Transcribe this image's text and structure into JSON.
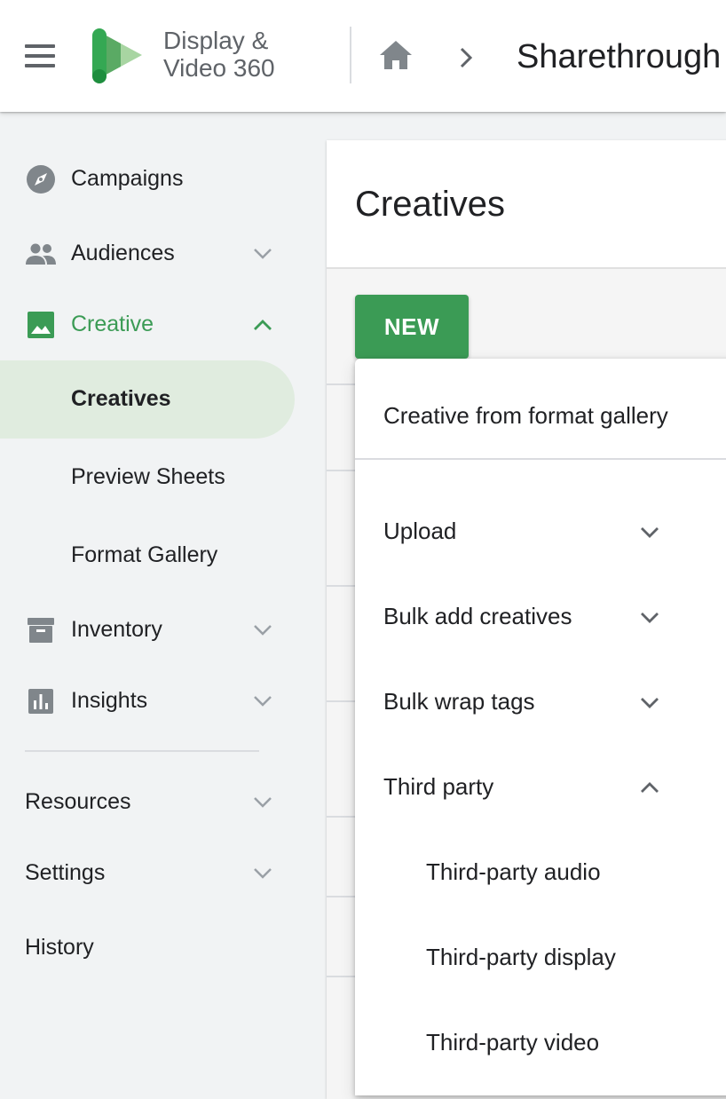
{
  "header": {
    "product_line1": "Display &",
    "product_line2": "Video 360",
    "account": "Sharethrough"
  },
  "sidebar": {
    "items": [
      {
        "label": "Campaigns",
        "icon": "compass-icon"
      },
      {
        "label": "Audiences",
        "icon": "people-icon",
        "chevron": "down"
      },
      {
        "label": "Creative",
        "icon": "image-icon",
        "chevron": "up",
        "expanded": true
      },
      {
        "label": "Inventory",
        "icon": "archive-icon",
        "chevron": "down"
      },
      {
        "label": "Insights",
        "icon": "bar-chart-icon",
        "chevron": "down"
      }
    ],
    "creative_sub": [
      "Creatives",
      "Preview Sheets",
      "Format Gallery"
    ],
    "bottom": [
      {
        "label": "Resources",
        "chevron": "down"
      },
      {
        "label": "Settings",
        "chevron": "down"
      },
      {
        "label": "History"
      }
    ]
  },
  "main": {
    "title": "Creatives",
    "new_button": "NEW"
  },
  "menu": {
    "gallery": "Creative from format gallery",
    "groups": [
      {
        "label": "Upload",
        "chevron": "down"
      },
      {
        "label": "Bulk add creatives",
        "chevron": "down"
      },
      {
        "label": "Bulk wrap tags",
        "chevron": "down"
      },
      {
        "label": "Third party",
        "chevron": "up"
      }
    ],
    "third_party": [
      "Third-party audio",
      "Third-party display",
      "Third-party video"
    ]
  },
  "colors": {
    "accent": "#3b9b55",
    "active_bg": "#e0ecdf",
    "icon_gray": "#80868b"
  }
}
